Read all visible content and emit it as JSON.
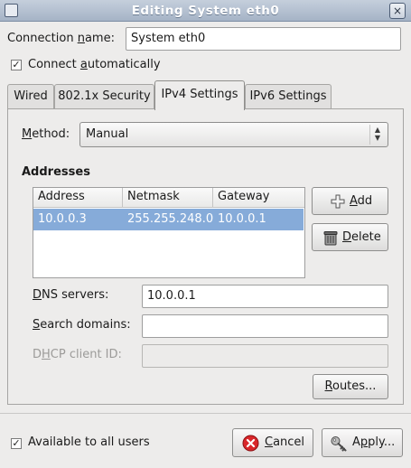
{
  "window": {
    "title": "Editing System eth0",
    "close_icon": "×"
  },
  "connection": {
    "name_label_pre": "Connection ",
    "name_label_u": "n",
    "name_label_post": "ame:",
    "name_value": "System eth0"
  },
  "connect_auto": {
    "pre": "Connect ",
    "u": "a",
    "post": "utomatically",
    "checked": true
  },
  "tabs": [
    {
      "label": "Wired"
    },
    {
      "label": "802.1x Security"
    },
    {
      "label": "IPv4 Settings",
      "active": true
    },
    {
      "label": "IPv6 Settings"
    }
  ],
  "ipv4": {
    "method_u": "M",
    "method_post": "ethod:",
    "method_value": "Manual",
    "addresses_heading": "Addresses",
    "columns": [
      "Address",
      "Netmask",
      "Gateway"
    ],
    "rows": [
      [
        "10.0.0.3",
        "255.255.248.0",
        "10.0.0.1"
      ]
    ],
    "add_u": "A",
    "add_post": "dd",
    "delete_u": "D",
    "delete_post": "elete",
    "dns_u": "D",
    "dns_post": "NS servers:",
    "dns_value": "10.0.0.1",
    "search_u": "S",
    "search_post": "earch domains:",
    "search_value": "",
    "dhcp_pre": "D",
    "dhcp_u": "H",
    "dhcp_post": "CP client ID:",
    "dhcp_value": "",
    "routes_u": "R",
    "routes_post": "outes..."
  },
  "footer": {
    "available_label": "Available to all users",
    "available_checked": true,
    "cancel_u": "C",
    "cancel_post": "ancel",
    "apply_u": "p",
    "apply_pre": "A",
    "apply_post": "ply..."
  },
  "colors": {
    "selection": "#86abd9",
    "titlebar": "#b4c0d0",
    "cancel_icon": "#d9262a"
  }
}
